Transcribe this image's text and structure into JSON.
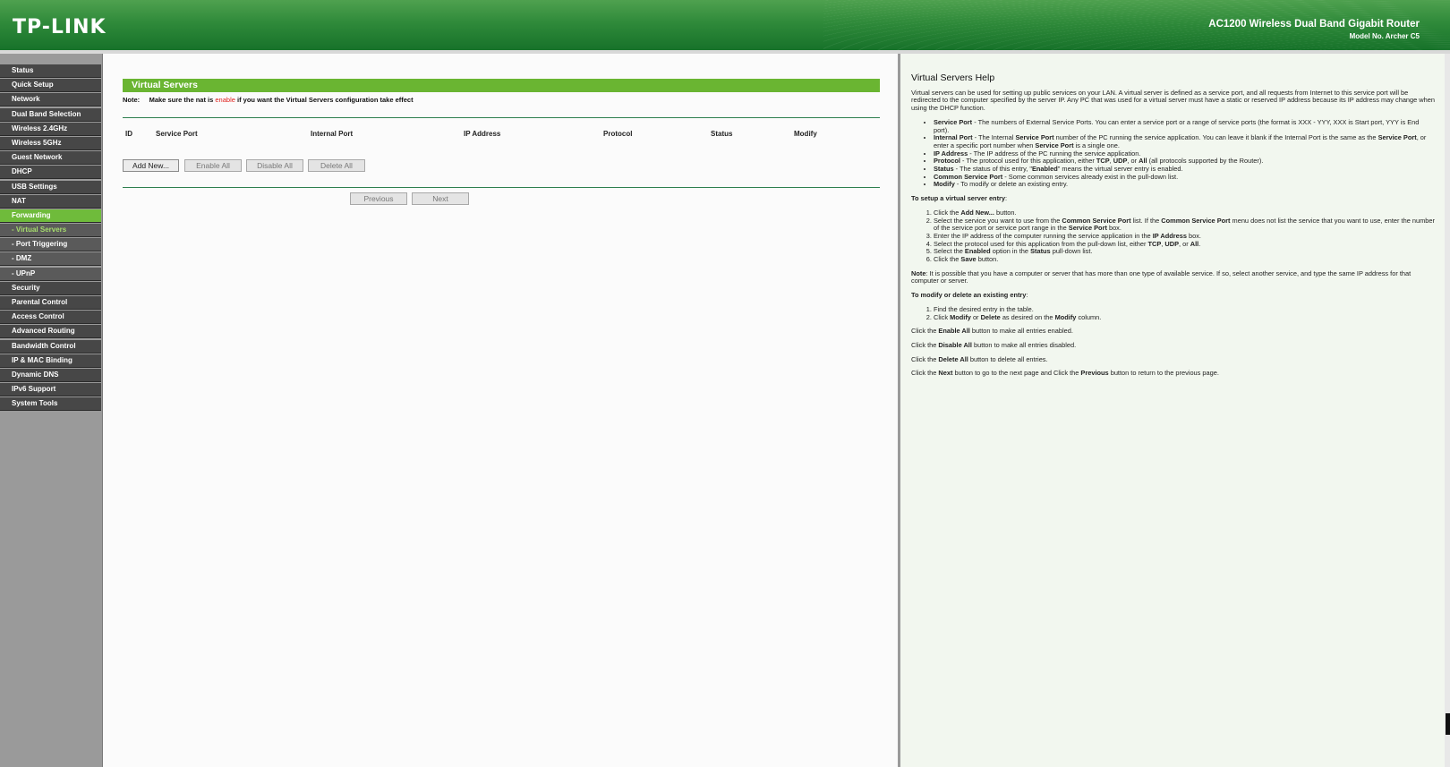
{
  "header": {
    "logo": "TP-LINK",
    "product": "AC1200 Wireless Dual Band Gigabit Router",
    "model": "Model No. Archer C5"
  },
  "menu": [
    {
      "label": "Status",
      "state": "normal"
    },
    {
      "label": "Quick Setup",
      "state": "normal"
    },
    {
      "label": "Network",
      "state": "normal"
    },
    {
      "label": "Dual Band Selection",
      "state": "normal"
    },
    {
      "label": "Wireless 2.4GHz",
      "state": "normal"
    },
    {
      "label": "Wireless 5GHz",
      "state": "normal"
    },
    {
      "label": "Guest Network",
      "state": "normal"
    },
    {
      "label": "DHCP",
      "state": "normal"
    },
    {
      "label": "USB Settings",
      "state": "normal"
    },
    {
      "label": "NAT",
      "state": "normal"
    },
    {
      "label": "Forwarding",
      "state": "active"
    },
    {
      "label": "- Virtual Servers",
      "state": "sub-active"
    },
    {
      "label": "- Port Triggering",
      "state": "sub"
    },
    {
      "label": "- DMZ",
      "state": "sub"
    },
    {
      "label": "- UPnP",
      "state": "sub"
    },
    {
      "label": "Security",
      "state": "normal"
    },
    {
      "label": "Parental Control",
      "state": "normal"
    },
    {
      "label": "Access Control",
      "state": "normal"
    },
    {
      "label": "Advanced Routing",
      "state": "normal"
    },
    {
      "label": "Bandwidth Control",
      "state": "normal"
    },
    {
      "label": "IP & MAC Binding",
      "state": "normal"
    },
    {
      "label": "Dynamic DNS",
      "state": "normal"
    },
    {
      "label": "IPv6 Support",
      "state": "normal"
    },
    {
      "label": "System Tools",
      "state": "normal"
    }
  ],
  "main": {
    "title": "Virtual Servers",
    "note_prefix": "Note:",
    "note_part1": "Make sure the nat is",
    "note_red": "enable",
    "note_part2": "if you want the Virtual Servers configuration take effect",
    "columns": [
      "ID",
      "Service Port",
      "Internal Port",
      "IP Address",
      "Protocol",
      "Status",
      "Modify"
    ],
    "buttons": {
      "add_new": "Add New...",
      "enable_all": "Enable All",
      "disable_all": "Disable All",
      "delete_all": "Delete All",
      "previous": "Previous",
      "next": "Next"
    }
  },
  "help": {
    "title": "Virtual Servers Help",
    "intro": "Virtual servers can be used for setting up public services on your LAN. A virtual server is defined as a service port, and all requests from Internet to this service port will be redirected to the computer specified by the server IP. Any PC that was used for a virtual server must have a static or reserved IP address because its IP address may change when using the DHCP function.",
    "items": [
      {
        "term": "Service Port",
        "desc": " - The numbers of External Service Ports. You can enter a service port or a range of service ports (the format is XXX - YYY, XXX is Start port, YYY is End port)."
      },
      {
        "term": "Internal Port",
        "desc": " - The Internal Service Port number of the PC running the service application. You can leave it blank if the Internal Port is the same as the Service Port, or enter a specific port number when Service Port is a single one."
      },
      {
        "term": "IP Address",
        "desc": " - The IP address of the PC running the service application."
      },
      {
        "term": "Protocol",
        "desc": " - The protocol used for this application, either TCP, UDP, or All (all protocols supported by the Router)."
      },
      {
        "term": "Status",
        "desc": " - The status of this entry, \"Enabled\" means the virtual server entry is enabled."
      },
      {
        "term": "Common Service Port",
        "desc": " - Some common services already exist in the pull-down list."
      },
      {
        "term": "Modify",
        "desc": " - To modify or delete an existing entry."
      }
    ],
    "setup_heading": "To setup a virtual server entry",
    "setup_steps": [
      "Click the Add New... button.",
      "Select the service you want to use from the Common Service Port list. If the Common Service Port menu does not list the service that you want to use, enter the number of the service port or service port range in the Service Port box.",
      "Enter the IP address of the computer running the service application in the IP Address box.",
      "Select the protocol used for this application from the pull-down list, either TCP, UDP, or All.",
      "Select the Enabled option in the Status pull-down list.",
      "Click the Save button."
    ],
    "note_label": "Note",
    "note_text": ": It is possible that you have a computer or server that has more than one type of available service. If so, select another service, and type the same IP address for that computer or server.",
    "modify_heading": "To modify or delete an existing entry",
    "modify_steps": [
      "Find the desired entry in the table.",
      "Click Modify or Delete as desired on the Modify column."
    ],
    "enable_line": "Click the Enable All button to make all entries enabled.",
    "disable_line": "Click the Disable All button to make all entries disabled.",
    "delete_line": "Click the Delete All button to delete all entries.",
    "nav_line": "Click the Next button to go to the next page and Click the Previous button to return to the previous page."
  }
}
